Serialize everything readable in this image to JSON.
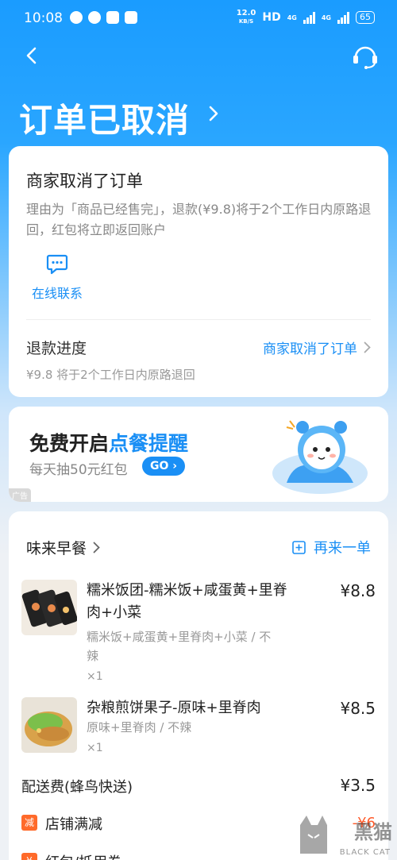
{
  "status_bar": {
    "time": "10:08",
    "net_speed_value": "12.0",
    "net_speed_unit": "KB/S",
    "hd": "HD",
    "signal_1": "4G",
    "signal_2": "4G",
    "battery": "65"
  },
  "nav": {
    "back_icon": "chevron-left-icon",
    "service_icon": "headset-icon"
  },
  "page": {
    "title": "订单已取消"
  },
  "status_card": {
    "heading": "商家取消了订单",
    "description": "理由为「商品已经售完」，退款(¥9.8)将于2个工作日内原路退回，红包将立即返回账户",
    "contact_label": "在线联系",
    "refund_label": "退款进度",
    "refund_status": "商家取消了订单",
    "refund_detail": "¥9.8 将于2个工作日内原路退回"
  },
  "ad_card": {
    "title_prefix": "免费开启",
    "title_highlight": "点餐提醒",
    "subtitle": "每天抽50元红包",
    "go_label": "GO",
    "ad_badge": "广告"
  },
  "order_card": {
    "shop_name": "味来早餐",
    "reorder_label": "再来一单",
    "items": [
      {
        "name": "糯米饭团-糯米饭+咸蛋黄+里脊肉+小菜",
        "spec": "糯米饭+咸蛋黄+里脊肉+小菜 / 不辣",
        "qty": "×1",
        "price": "¥8.8"
      },
      {
        "name": "杂粮煎饼果子-原味+里脊肉",
        "spec": "原味+里脊肉 / 不辣",
        "qty": "×1",
        "price": "¥8.5"
      }
    ],
    "delivery_fee_label": "配送费(蜂鸟快送)",
    "delivery_fee": "¥3.5",
    "discount_tag": "减",
    "discount_label": "店铺满减",
    "discount_value": "-¥6",
    "coupon_label": "红包/抵用券"
  },
  "watermark": {
    "text": "黑猫",
    "sub": "BLACK CAT"
  },
  "colors": {
    "brand_blue": "#1a8ff5",
    "header_blue": "#1a9cff",
    "discount_orange": "#ff6a2a"
  }
}
